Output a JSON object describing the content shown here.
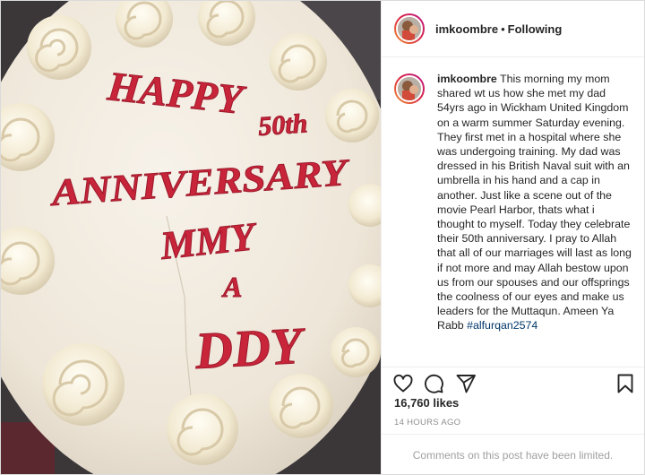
{
  "post": {
    "username": "imkoombre",
    "follow_status": "Following",
    "separator": "•",
    "caption": "This morning my mom shared wt us how she met my dad 54yrs ago in Wickham United Kingdom on a warm summer Saturday evening. They first met in a hospital where she was undergoing training. My dad was dressed in his British Naval suit with an umbrella in his hand and a cap in another. Just like a scene out of the movie Pearl Harbor, thats what i thought to myself. Today they celebrate their 50th anniversary. I pray to Allah that all of our marriages will last as long if not more and may Allah bestow upon us from our spouses and our offsprings the coolness of our eyes and make us leaders for the Muttaqun. Ameen Ya Rabb",
    "hashtag": "#alfurqan2574",
    "likes": "16,760 likes",
    "timestamp": "14 HOURS AGO",
    "comments_notice": "Comments on this post have been limited."
  },
  "photo": {
    "cake_text": [
      "HAPPY",
      "50th",
      "ANNIVERSARY",
      "MMY",
      "A",
      "DDY"
    ],
    "frosting_color": "#c8243a",
    "cake_color": "#f1ebe0"
  },
  "icons": {
    "like": "heart-icon",
    "comment": "comment-icon",
    "share": "paper-plane-icon",
    "save": "bookmark-icon"
  }
}
